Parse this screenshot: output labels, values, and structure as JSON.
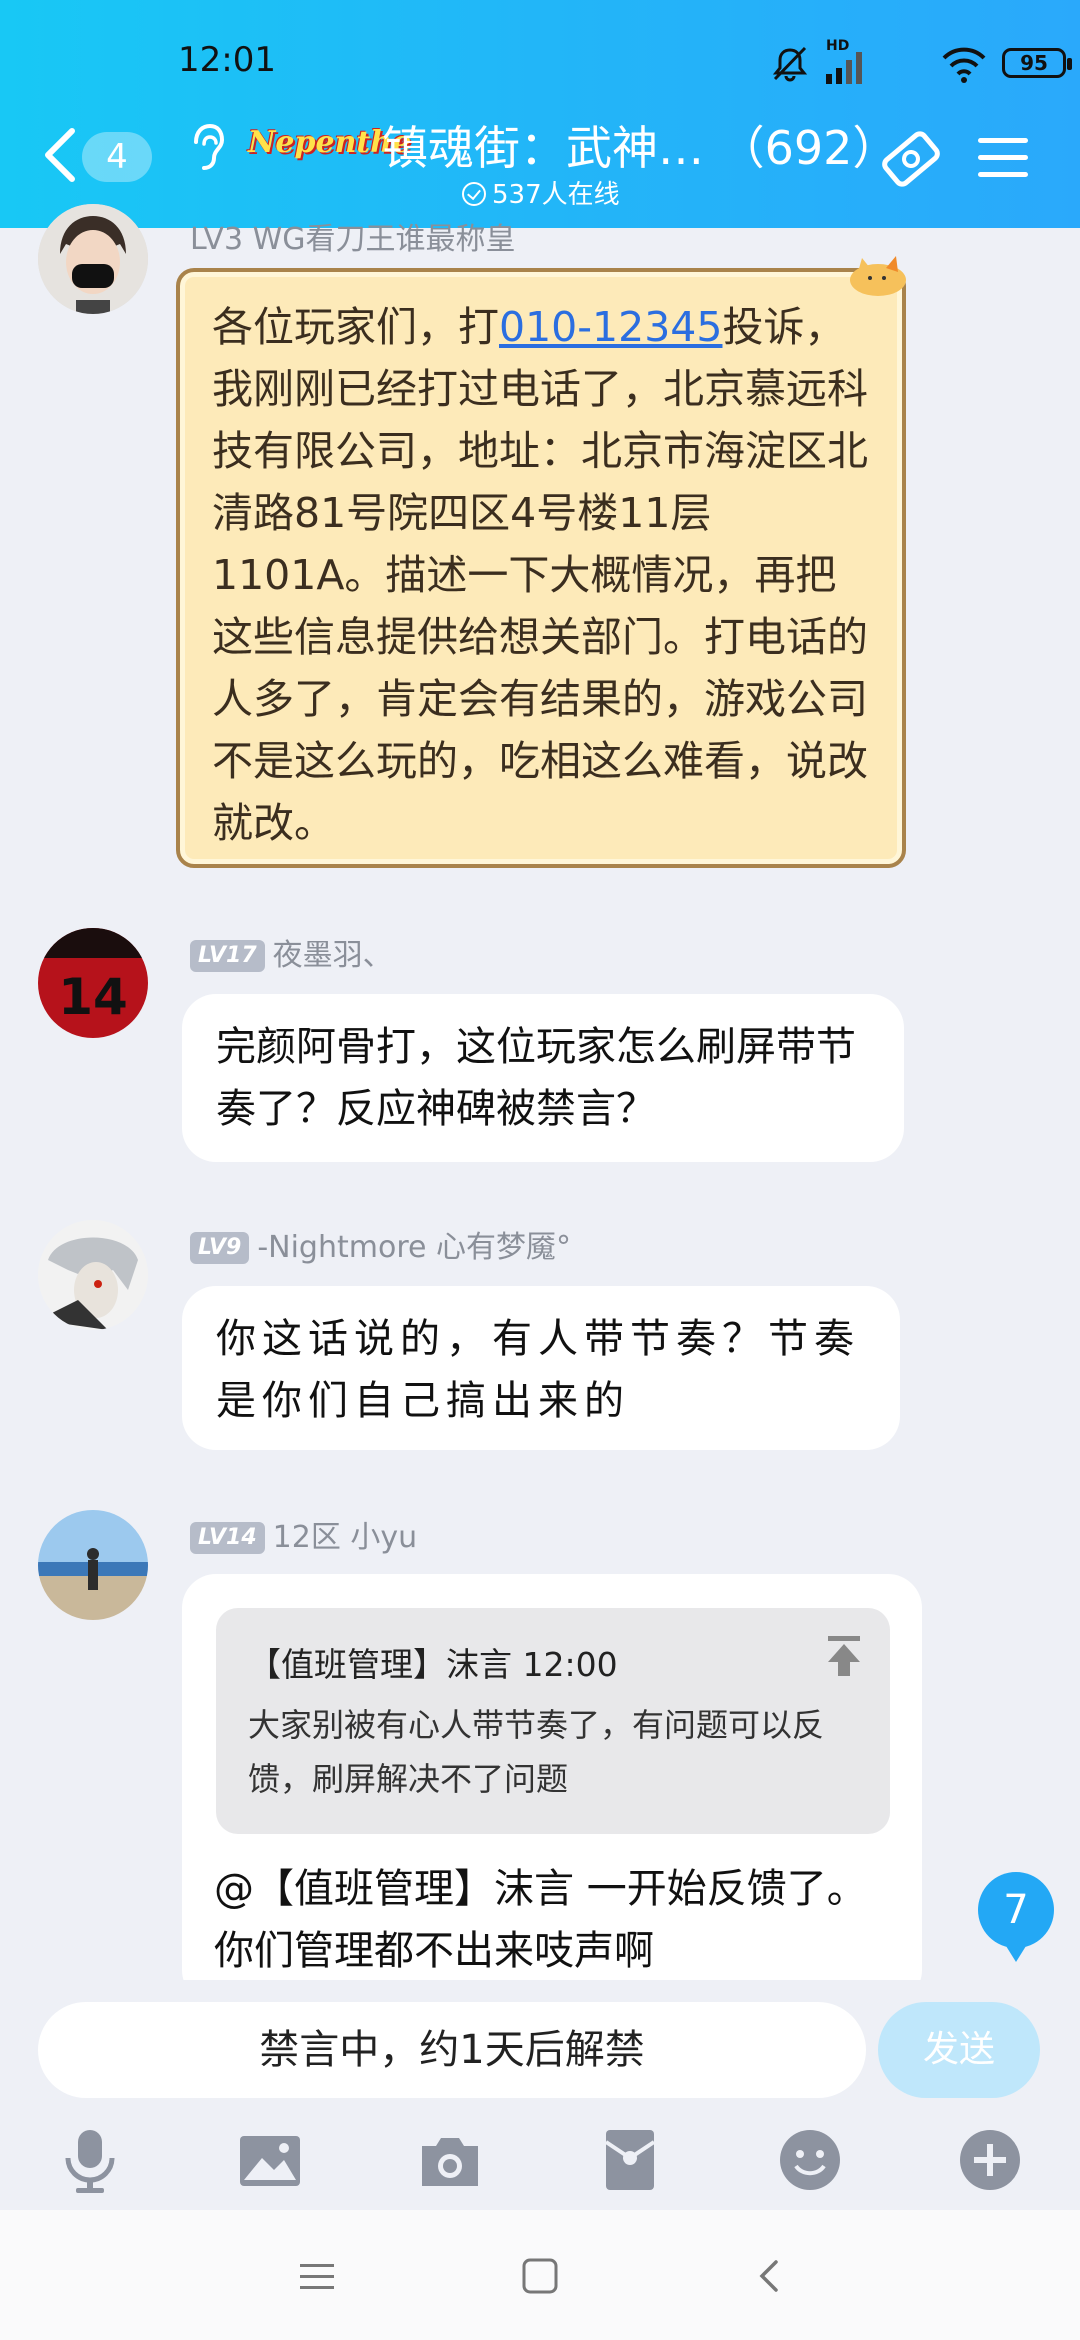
{
  "status_bar": {
    "time": "12:01",
    "battery": "95",
    "hd_label": "HD",
    "icons": [
      "mute-bell-icon",
      "signal-icon",
      "wifi-icon",
      "battery-icon"
    ]
  },
  "header": {
    "back_count": "4",
    "logo_text": "Nepenthe",
    "title": "镇魂街：武神…  （692）",
    "online": "537人在线",
    "accent": "#22b6f8"
  },
  "messages": [
    {
      "sender_meta": "LV3 WG看刀王谁最称皇",
      "text_before": "各位玩家们，打",
      "phone": "010-12345",
      "text_after": "投诉，我刚刚已经打过电话了，北京慕远科技有限公司，地址：北京市海淀区北清路81号院四区4号楼11层1101A。描述一下大概情况，再把这些信息提供给想关部门。打电话的人多了，肯定会有结果的，游戏公司不是这么玩的，吃相这么难看，说改就改。"
    },
    {
      "level": "LV17",
      "sender": "夜墨羽、",
      "text": "完颜阿骨打，这位玩家怎么刷屏带节奏了？反应神碑被禁言？"
    },
    {
      "level": "LV9",
      "sender": "-Nightmore 心有梦魇°",
      "text": "你这话说的，有人带节奏？节奏是你们自己搞出来的"
    },
    {
      "level": "LV14",
      "sender": "12区 小yu",
      "reply_name": "【值班管理】沫言  12:00",
      "reply_text": "大家别被有心人带节奏了，有问题可以反馈，刷屏解决不了问题",
      "text": "@【值班管理】沫言 一开始反馈了。你们管理都不出来吱声啊"
    }
  ],
  "unread_badge": "7",
  "input": {
    "mute_text": "禁言中，约1天后解禁",
    "send_label": "发送"
  },
  "toolbar_icons": [
    "microphone-icon",
    "image-icon",
    "camera-icon",
    "red-packet-icon",
    "emoji-icon",
    "plus-icon"
  ],
  "nav_icons": [
    "menu-icon",
    "home-icon",
    "back-icon"
  ]
}
